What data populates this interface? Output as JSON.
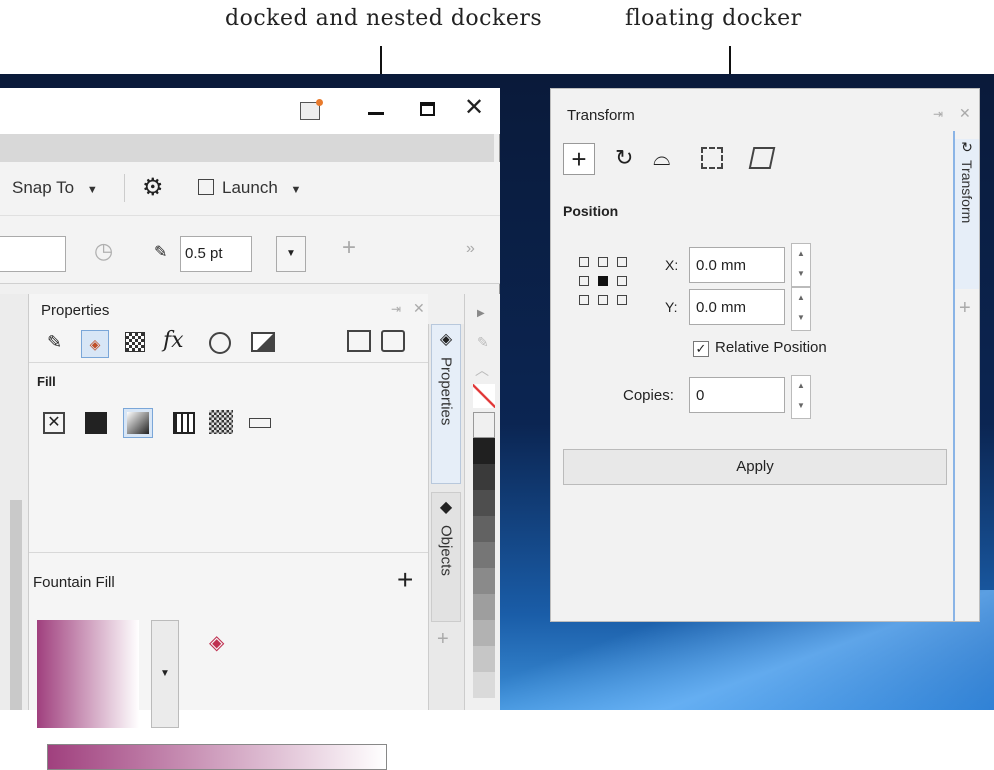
{
  "annotations": {
    "docked_label": "docked and nested dockers",
    "floating_label": "floating docker"
  },
  "app": {
    "toolbar": {
      "snap_to": "Snap To",
      "launch": "Launch",
      "outline_width": "0.5 pt"
    },
    "properties_docker": {
      "title": "Properties",
      "fill_label": "Fill",
      "fountain_fill_label": "Fountain Fill"
    },
    "tabs": {
      "properties": "Properties",
      "objects": "Objects"
    },
    "palette_colors": [
      "#f0f0f0",
      "#202020",
      "#3a3a3a",
      "#4e4e4e",
      "#626262",
      "#767676",
      "#8a8a8a",
      "#9e9e9e",
      "#b2b2b2",
      "#c6c6c6",
      "#dadada"
    ],
    "fountain_colors": {
      "start": "#a0407e",
      "end": "#ffffff"
    }
  },
  "transform_docker": {
    "title": "Transform",
    "position_label": "Position",
    "x_label": "X:",
    "x_value": "0.0 mm",
    "y_label": "Y:",
    "y_value": "0.0 mm",
    "relative_position": "Relative Position",
    "copies_label": "Copies:",
    "copies_value": "0",
    "apply": "Apply",
    "tab_label": "Transform"
  }
}
